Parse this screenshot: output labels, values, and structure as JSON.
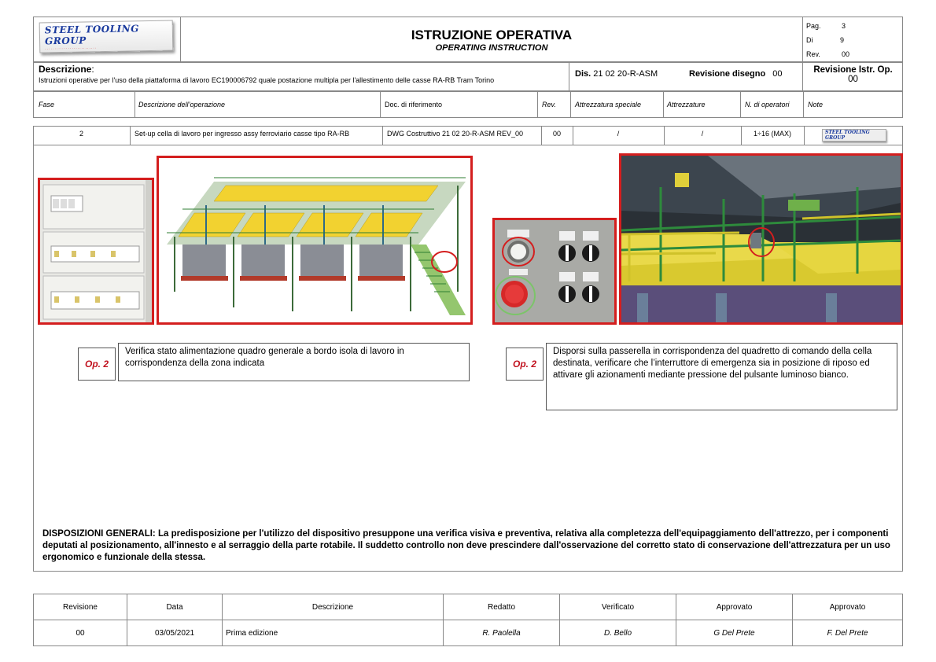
{
  "header": {
    "logo": "STEEL TOOLING GROUP",
    "title": "ISTRUZIONE OPERATIVA",
    "subtitle": "OPERATING INSTRUCTION",
    "page_label": "Pag.",
    "page_value": "3",
    "of_label": "Di",
    "of_value": "9",
    "rev_label": "Rev.",
    "rev_value": "00"
  },
  "description": {
    "label": "Descrizione",
    "colon": ":",
    "text": "Istruzioni operative per l'uso della piattaforma di lavoro EC190006792 quale postazione multipla per l'allestimento delle casse RA-RB Tram Torino",
    "dis_label": "Dis.",
    "dis_value": "21 02 20-R-ASM",
    "rev_dis_label": "Revisione disegno",
    "rev_dis_value": "00",
    "rev_istr_label": "Revisione Istr. Op.",
    "rev_istr_value": "00"
  },
  "columns": {
    "fase": "Fase",
    "descr": "Descrizione dell’operazione",
    "doc": "Doc. di riferimento",
    "rev": "Rev.",
    "attr_spec": "Attrezzatura speciale",
    "attr": "Attrezzature",
    "n_op": "N. di operatori",
    "note": "Note"
  },
  "row": {
    "fase": "2",
    "descr": "Set-up cella di lavoro per ingresso assy ferroviario casse tipo RA-RB",
    "doc": "DWG Costruttivo  21 02 20-R-ASM REV_00",
    "rev": "00",
    "attr_spec": "/",
    "attr": "/",
    "n_op": "1÷16 (MAX)"
  },
  "ops": [
    {
      "label": "Op. 2",
      "text": "Verifica stato alimentazione quadro generale a bordo isola di lavoro in corrispondenza della zona indicata"
    },
    {
      "label": "Op. 2",
      "text": "Disporsi sulla passerella in corrispondenza del quadretto di comando della cella destinata, verificare che l’interruttore di emergenza sia in posizione di riposo ed attivare gli azionamenti mediante pressione del pulsante luminoso bianco."
    }
  ],
  "general": "DISPOSIZIONI GENERALI: La predisposizione per l'utilizzo del dispositivo presuppone una verifica visiva e preventiva, relativa alla completezza dell'equipaggiamento dell'attrezzo, per i componenti deputati al posizionamento, all'innesto e al serraggio della parte rotabile. Il suddetto controllo non deve prescindere dall'osservazione del corretto stato di conservazione dell'attrezzatura per un uso ergonomico e funzionale della stessa.",
  "revisions": {
    "headers": [
      "Revisione",
      "Data",
      "Descrizione",
      "Redatto",
      "Verificato",
      "Approvato",
      "Approvato"
    ],
    "values": [
      "00",
      "03/05/2021",
      "Prima edizione",
      "R. Paolella",
      "D. Bello",
      "G Del Prete",
      "F. Del Prete"
    ]
  },
  "colors": {
    "highlight_red": "#d41e1e",
    "op_label_red": "#c1121f",
    "structure_yellow": "#f2d230",
    "structure_green": "#3c8a3c"
  }
}
